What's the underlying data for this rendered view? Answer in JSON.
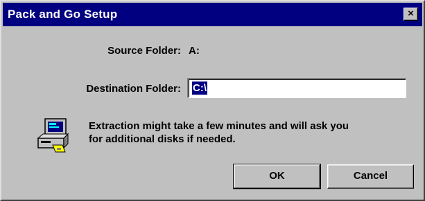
{
  "window": {
    "title": "Pack and Go Setup",
    "close_glyph": "×"
  },
  "form": {
    "source_label": "Source Folder:",
    "source_value": "A:",
    "destination_label": "Destination Folder:",
    "destination_value": "C:\\"
  },
  "message": {
    "line1": "Extraction might take a few minutes and will ask you",
    "line2": "for additional disks if needed."
  },
  "buttons": {
    "ok_label": "OK",
    "cancel_label": "Cancel"
  },
  "icons": {
    "computer": "computer-disk-icon",
    "close": "close-icon"
  },
  "colors": {
    "titlebar": "#000080",
    "face": "#c0c0c0",
    "selection": "#000080"
  }
}
